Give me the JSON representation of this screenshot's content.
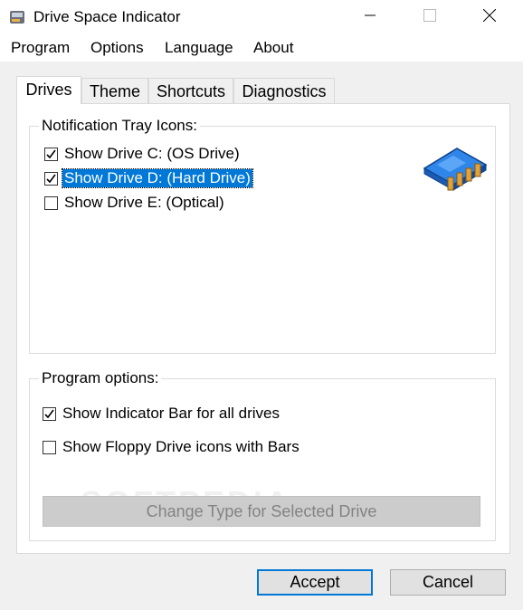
{
  "window": {
    "title": "Drive Space Indicator",
    "icons": {
      "app": "drive-app-icon",
      "minimize": "minimize-icon",
      "maximize": "maximize-icon",
      "close": "close-icon"
    }
  },
  "menu": [
    "Program",
    "Options",
    "Language",
    "About"
  ],
  "tabs": [
    {
      "label": "Drives",
      "active": true
    },
    {
      "label": "Theme",
      "active": false
    },
    {
      "label": "Shortcuts",
      "active": false
    },
    {
      "label": "Diagnostics",
      "active": false
    }
  ],
  "tray_group": {
    "label": "Notification Tray Icons:",
    "items": [
      {
        "label": "Show Drive C: (OS Drive)",
        "checked": true,
        "selected": false
      },
      {
        "label": "Show Drive D: (Hard Drive)",
        "checked": true,
        "selected": true
      },
      {
        "label": "Show Drive E: (Optical)",
        "checked": false,
        "selected": false
      }
    ],
    "image_icon": "memory-chip-icon"
  },
  "options_group": {
    "label": "Program options:",
    "items": [
      {
        "label": "Show Indicator Bar for all drives",
        "checked": true
      },
      {
        "label": "Show Floppy Drive icons with Bars",
        "checked": false
      }
    ],
    "action_button": {
      "label": "Change Type for Selected Drive",
      "enabled": false
    }
  },
  "buttons": {
    "accept": "Accept",
    "cancel": "Cancel"
  },
  "watermark": "SOFTPEDIA",
  "colors": {
    "accent": "#0078d7",
    "window_bg": "#f0f0f0",
    "panel_bg": "#ffffff",
    "disabled_button": "#cccccc"
  }
}
